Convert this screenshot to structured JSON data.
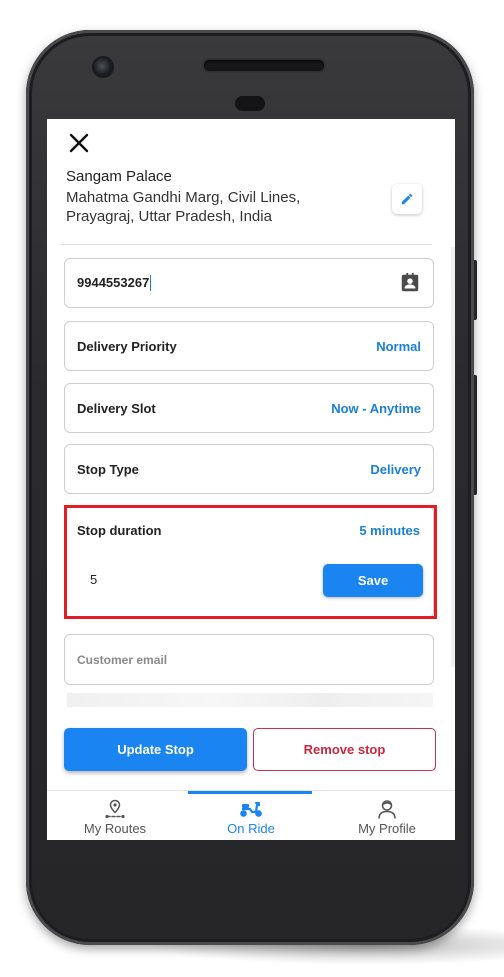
{
  "header": {
    "stop_name": "Sangam Palace",
    "address": "Mahatma Gandhi Marg, Civil Lines, Prayagraj, Uttar Pradesh, India"
  },
  "form": {
    "phone_value": "9944553267",
    "priority": {
      "label": "Delivery Priority",
      "value": "Normal"
    },
    "slot": {
      "label": "Delivery Slot",
      "value": "Now - Anytime"
    },
    "stop_type": {
      "label": "Stop Type",
      "value": "Delivery"
    },
    "duration": {
      "label": "Stop duration",
      "value": "5 minutes",
      "input_value": "5",
      "save_label": "Save"
    },
    "email_placeholder": "Customer email"
  },
  "actions": {
    "update_label": "Update Stop",
    "remove_label": "Remove stop"
  },
  "tabs": [
    {
      "label": "My Routes",
      "icon": "route-pin-icon",
      "active": false
    },
    {
      "label": "On Ride",
      "icon": "scooter-icon",
      "active": true
    },
    {
      "label": "My Profile",
      "icon": "person-icon",
      "active": false
    }
  ],
  "colors": {
    "accent": "#1a85f0",
    "highlight": "#e21d26",
    "remove": "#c8283e"
  }
}
